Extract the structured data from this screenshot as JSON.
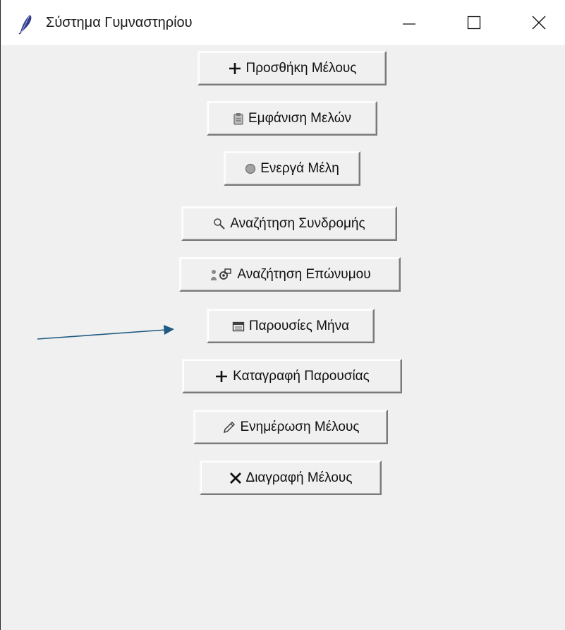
{
  "window": {
    "title": "Σύστημα Γυμναστηρίου"
  },
  "controls": {
    "minimize": "minimize-icon",
    "maximize": "maximize-icon",
    "close": "close-icon"
  },
  "buttons": [
    {
      "label": "Προσθήκη Μέλους",
      "icon": "plus-icon"
    },
    {
      "label": "Εμφάνιση Μελών",
      "icon": "clipboard-icon"
    },
    {
      "label": "Ενεργά Μέλη",
      "icon": "gray-circle-icon"
    },
    {
      "label": "Αναζήτηση Συνδρομής",
      "icon": "magnifier-icon"
    },
    {
      "label": "Αναζήτηση Επώνυμου",
      "icon": "person-search-icon"
    },
    {
      "label": "Παρουσίες Μήνα",
      "icon": "calendar-icon"
    },
    {
      "label": "Καταγραφή Παρουσίας",
      "icon": "plus-icon"
    },
    {
      "label": "Ενημέρωση Μέλους",
      "icon": "pencil-icon"
    },
    {
      "label": "Διαγραφή Μέλους",
      "icon": "x-icon"
    }
  ],
  "colors": {
    "annotation_arrow": "#1f5a82",
    "window_bg": "#f0f0f0"
  }
}
